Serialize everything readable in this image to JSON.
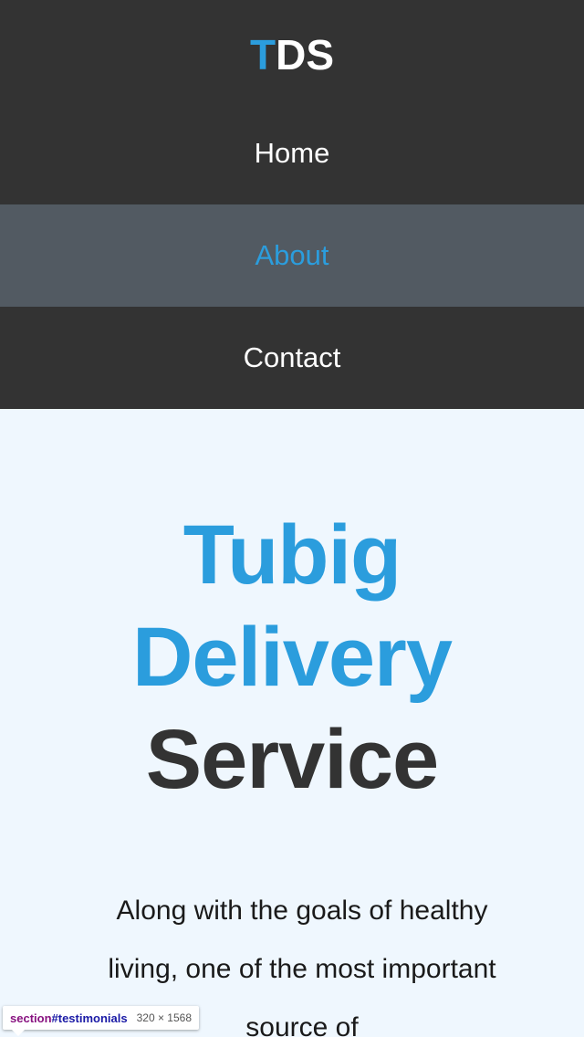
{
  "logo": {
    "accent": "T",
    "rest": "DS"
  },
  "nav": {
    "items": [
      {
        "label": "Home"
      },
      {
        "label": "About"
      },
      {
        "label": "Contact"
      }
    ],
    "active": "About"
  },
  "hero": {
    "line1": "Tubig",
    "line2": "Delivery",
    "line3": "Service"
  },
  "about": {
    "text": "Along with the goals of healthy living, one of the most important source of"
  },
  "devtools": {
    "tag": "section",
    "id": "#testimonials",
    "dims": "320 × 1568"
  },
  "colors": {
    "accent": "#2b9ddd",
    "header_bg": "#333333",
    "active_bg": "#525a62",
    "page_bg": "#eff7fe"
  }
}
